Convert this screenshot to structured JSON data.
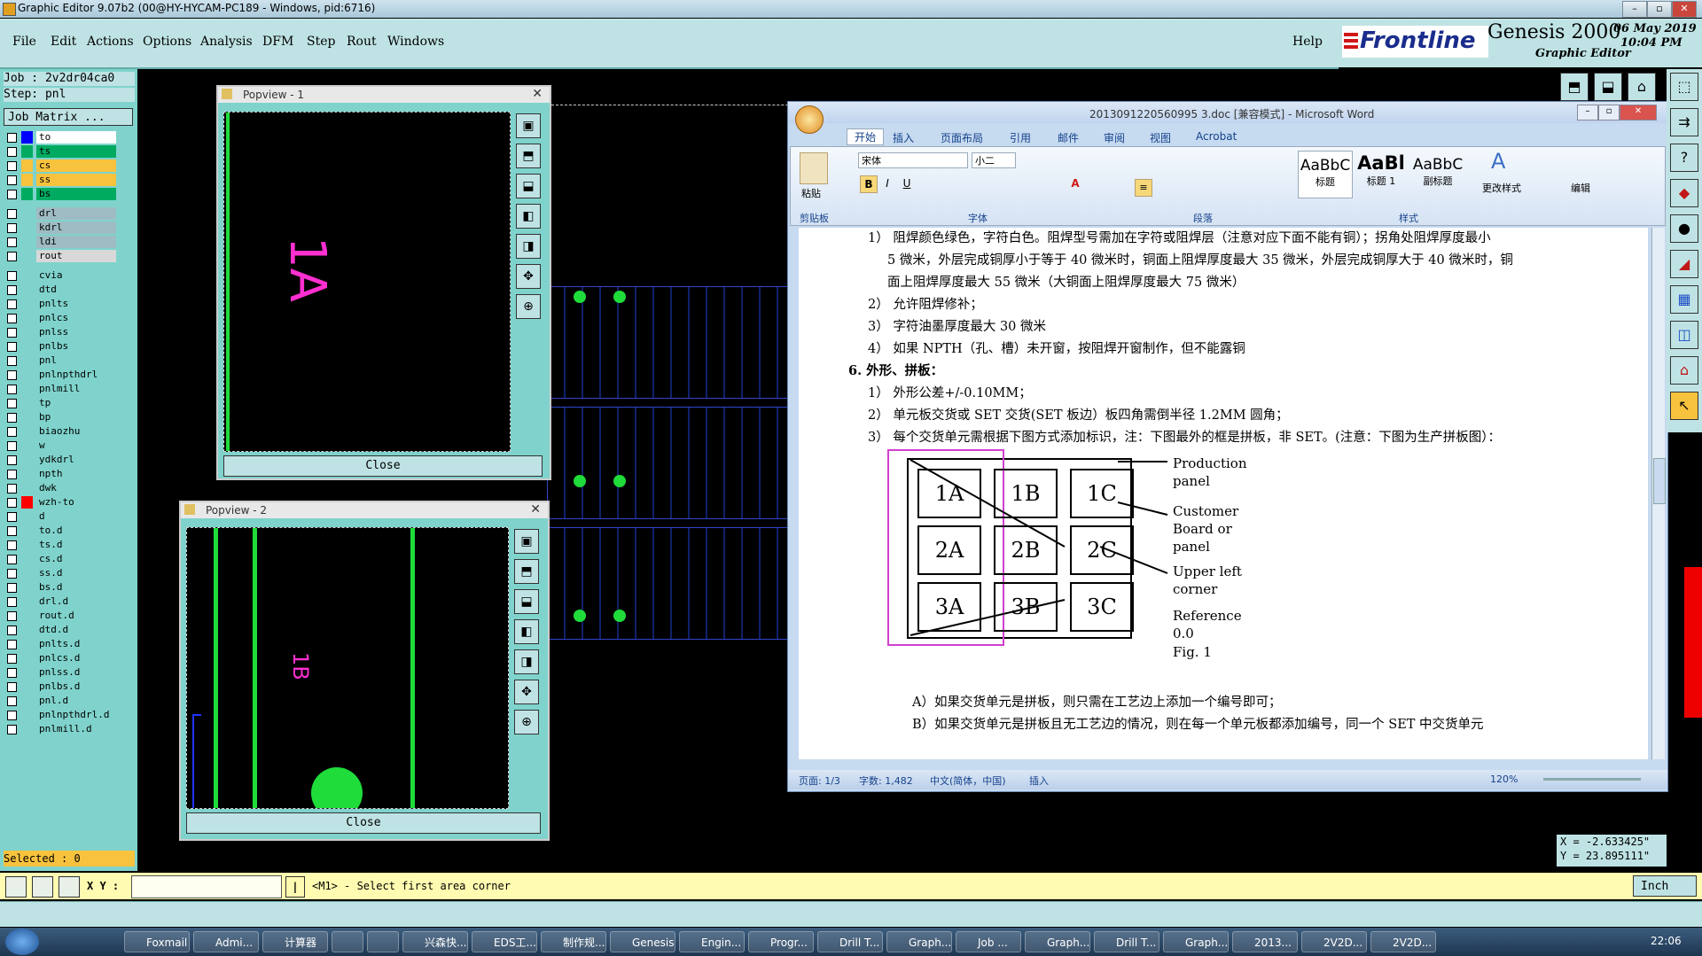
{
  "window_title": "Graphic Editor 9.07b2 (00@HY-HYCAM-PC189 - Windows, pid:6716)",
  "menu": [
    "File",
    "Edit",
    "Actions",
    "Options",
    "Analysis",
    "DFM",
    "Step",
    "Rout",
    "Windows"
  ],
  "help": "Help",
  "brand": {
    "logo": "Frontline",
    "product": "Genesis 2000",
    "subtitle": "Graphic Editor",
    "date": "06 May 2019",
    "time": "10:04 PM"
  },
  "job_label": "Job : 2v2dr04ca0",
  "step_label": "Step: pnl",
  "job_matrix": "Job Matrix ...",
  "layers": [
    {
      "name": "to",
      "swatch": "#0000ff",
      "bg": "#ffffff"
    },
    {
      "name": "ts",
      "swatch": "#00aa60",
      "bg": "#00aa60"
    },
    {
      "name": "cs",
      "swatch": "#f7c23e",
      "bg": "#f7c23e"
    },
    {
      "name": "ss",
      "swatch": "#f7c23e",
      "bg": "#f7c23e"
    },
    {
      "name": "bs",
      "swatch": "#00aa60",
      "bg": "#00aa60"
    },
    {
      "name": "drl",
      "swatch": "",
      "bg": "#9fbcc4"
    },
    {
      "name": "kdrl",
      "swatch": "",
      "bg": "#9fbcc4"
    },
    {
      "name": "ldi",
      "swatch": "",
      "bg": "#9fbcc4"
    },
    {
      "name": "rout",
      "swatch": "",
      "bg": "#d8d8d8"
    },
    {
      "name": "cvia",
      "swatch": "",
      "bg": "#7fd3cc"
    },
    {
      "name": "dtd",
      "swatch": "",
      "bg": "#7fd3cc"
    },
    {
      "name": "pnlts",
      "swatch": "",
      "bg": "#7fd3cc"
    },
    {
      "name": "pnlcs",
      "swatch": "",
      "bg": "#7fd3cc"
    },
    {
      "name": "pnlss",
      "swatch": "",
      "bg": "#7fd3cc"
    },
    {
      "name": "pnlbs",
      "swatch": "",
      "bg": "#7fd3cc"
    },
    {
      "name": "pnl",
      "swatch": "",
      "bg": "#7fd3cc"
    },
    {
      "name": "pnlnpthdrl",
      "swatch": "",
      "bg": "#7fd3cc"
    },
    {
      "name": "pnlmill",
      "swatch": "",
      "bg": "#7fd3cc"
    },
    {
      "name": "tp",
      "swatch": "",
      "bg": "#7fd3cc"
    },
    {
      "name": "bp",
      "swatch": "",
      "bg": "#7fd3cc"
    },
    {
      "name": "biaozhu",
      "swatch": "",
      "bg": "#7fd3cc"
    },
    {
      "name": "w",
      "swatch": "",
      "bg": "#7fd3cc"
    },
    {
      "name": "ydkdrl",
      "swatch": "",
      "bg": "#7fd3cc"
    },
    {
      "name": "npth",
      "swatch": "",
      "bg": "#7fd3cc"
    },
    {
      "name": "dwk",
      "swatch": "",
      "bg": "#7fd3cc"
    },
    {
      "name": "wzh-to",
      "swatch": "#ff0000",
      "bg": "#7fd3cc"
    },
    {
      "name": "d",
      "swatch": "",
      "bg": "#7fd3cc"
    },
    {
      "name": "to.d",
      "swatch": "",
      "bg": "#7fd3cc"
    },
    {
      "name": "ts.d",
      "swatch": "",
      "bg": "#7fd3cc"
    },
    {
      "name": "cs.d",
      "swatch": "",
      "bg": "#7fd3cc"
    },
    {
      "name": "ss.d",
      "swatch": "",
      "bg": "#7fd3cc"
    },
    {
      "name": "bs.d",
      "swatch": "",
      "bg": "#7fd3cc"
    },
    {
      "name": "drl.d",
      "swatch": "",
      "bg": "#7fd3cc"
    },
    {
      "name": "rout.d",
      "swatch": "",
      "bg": "#7fd3cc"
    },
    {
      "name": "dtd.d",
      "swatch": "",
      "bg": "#7fd3cc"
    },
    {
      "name": "pnlts.d",
      "swatch": "",
      "bg": "#7fd3cc"
    },
    {
      "name": "pnlcs.d",
      "swatch": "",
      "bg": "#7fd3cc"
    },
    {
      "name": "pnlss.d",
      "swatch": "",
      "bg": "#7fd3cc"
    },
    {
      "name": "pnlbs.d",
      "swatch": "",
      "bg": "#7fd3cc"
    },
    {
      "name": "pnl.d",
      "swatch": "",
      "bg": "#7fd3cc"
    },
    {
      "name": "pnlnpthdrl.d",
      "swatch": "",
      "bg": "#7fd3cc"
    },
    {
      "name": "pnlmill.d",
      "swatch": "",
      "bg": "#7fd3cc"
    }
  ],
  "selected": "Selected : 0",
  "popview1": {
    "title": "Popview - 1",
    "label": "1A",
    "close": "Close"
  },
  "popview2": {
    "title": "Popview - 2",
    "label": "1B",
    "close": "Close"
  },
  "word": {
    "title": "2013091220560995 3.doc [兼容模式] - Microsoft Word",
    "tabs": [
      "开始",
      "插入",
      "页面布局",
      "引用",
      "邮件",
      "审阅",
      "视图",
      "Acrobat"
    ],
    "font": "宋体",
    "size": "小二",
    "groups": [
      "剪贴板",
      "字体",
      "段落",
      "样式",
      "编辑"
    ],
    "paste": "粘贴",
    "styles": [
      {
        "sample": "AaBbC",
        "name": "标题"
      },
      {
        "sample": "AaBl",
        "name": "标题 1"
      },
      {
        "sample": "AaBbC",
        "name": "副标题"
      }
    ],
    "change_styles": "更改样式",
    "edit": "编辑",
    "lines": [
      "1） 阻焊颜色绿色，字符白色。阻焊型号需加在字符或阻焊层（注意对应下面不能有铜）；拐角处阻焊厚度最小",
      "5 微米，外层完成铜厚小于等于 40 微米时，铜面上阻焊厚度最大 35 微米，外层完成铜厚大于 40 微米时，铜",
      "面上阻焊厚度最大 55 微米（大铜面上阻焊厚度最大 75 微米）",
      "2） 允许阻焊修补；",
      "3） 字符油墨厚度最大 30 微米",
      "4） 如果 NPTH（孔、槽）未开窗，按阻焊开窗制作，但不能露铜",
      "6.  外形、拼板：",
      "1） 外形公差+/-0.10MM；",
      "2） 单元板交货或 SET 交货(SET 板边）板四角需倒半径 1.2MM 圆角；",
      "3） 每个交货单元需根据下图方式添加标识，注：下图最外的框是拼板，非 SET。(注意：下图为生产拼板图）："
    ],
    "figure": {
      "cells": [
        "1A",
        "1B",
        "1C",
        "2A",
        "2B",
        "2C",
        "3A",
        "3B",
        "3C"
      ],
      "labels": [
        "Production panel",
        "Customer Board or panel",
        "Upper left corner",
        "Reference 0.0",
        "Fig. 1"
      ]
    },
    "after": [
      "A）如果交货单元是拼板，则只需在工艺边上添加一个编号即可；",
      "B）如果交货单元是拼板且无工艺边的情况，则在每一个单元板都添加编号，同一个 SET 中交货单元"
    ],
    "status": {
      "page": "页面: 1/3",
      "words": "字数: 1,482",
      "lang": "中文(简体，中国)",
      "mode": "插入",
      "zoom": "120%"
    }
  },
  "coords": {
    "x": "X = -2.633425\"",
    "y": "Y = 23.895111\""
  },
  "cmd": {
    "xy_label": "X Y :",
    "xy_value": "",
    "prompt": "<M1> - Select first area corner",
    "unit": "Inch"
  },
  "taskbar": {
    "items": [
      "Foxmail",
      "Admi...",
      "计算器",
      "",
      "",
      "兴森快...",
      "EDS工...",
      "制作规...",
      "Genesis",
      "Engin...",
      "Progr...",
      "Drill T...",
      "Graph...",
      "Job ...",
      "Graph...",
      "Drill T...",
      "Graph...",
      "2013...",
      "2V2D...",
      "2V2D..."
    ],
    "clock": "22:06"
  }
}
